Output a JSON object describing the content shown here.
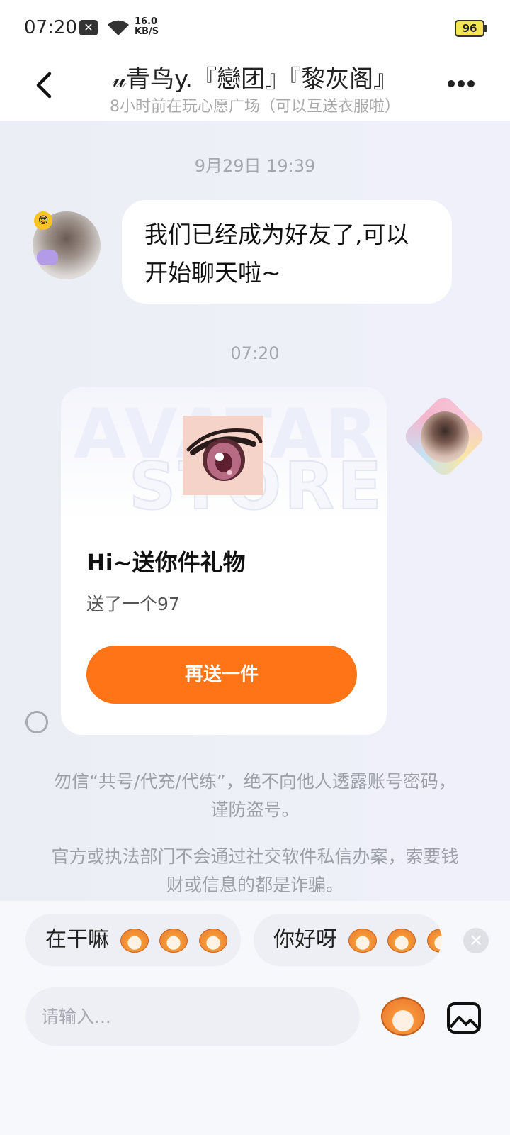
{
  "status_bar": {
    "time": "07:20",
    "notification_icon": "x-box-icon",
    "net_speed_value": "16.0",
    "net_speed_unit": "KB/S",
    "battery": "96"
  },
  "header": {
    "title": "𝓊青鸟y.『戀团』『黎灰阁』",
    "subtitle": "8小时前在玩心愿广场（可以互送衣服啦）"
  },
  "messages": [
    {
      "type": "timestamp",
      "text": "9月29日 19:39"
    },
    {
      "type": "text",
      "side": "left",
      "text": "我们已经成为好友了,可以开始聊天啦~"
    },
    {
      "type": "timestamp",
      "text": "07:20"
    },
    {
      "type": "gift",
      "side": "right",
      "watermark_line1": "AVATAR",
      "watermark_line2": "STORE",
      "title": "Hi~送你件礼物",
      "description": "送了一个97",
      "button": "再送一件"
    }
  ],
  "notices": [
    "勿信“共号/代充/代练”，绝不向他人透露账号密码，谨防盗号。",
    "官方或执法部门不会通过社交软件私信办案，索要钱财或信息的都是诈骗。"
  ],
  "quick_replies": [
    {
      "text": "在干嘛",
      "emoji_count": 3
    },
    {
      "text": "你好呀",
      "emoji_count": 3
    }
  ],
  "input": {
    "placeholder": "请输入..."
  },
  "colors": {
    "accent": "#ff7416",
    "background": "#eef0f7",
    "bubble": "#ffffff",
    "muted_text": "#a5a8b0"
  }
}
